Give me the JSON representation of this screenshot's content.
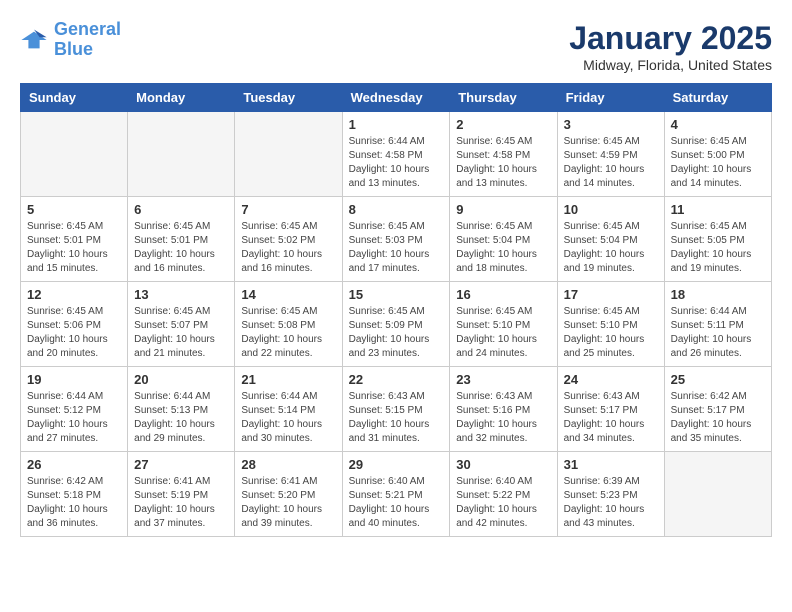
{
  "header": {
    "logo_line1": "General",
    "logo_line2": "Blue",
    "title": "January 2025",
    "subtitle": "Midway, Florida, United States"
  },
  "weekdays": [
    "Sunday",
    "Monday",
    "Tuesday",
    "Wednesday",
    "Thursday",
    "Friday",
    "Saturday"
  ],
  "weeks": [
    [
      {
        "day": "",
        "info": ""
      },
      {
        "day": "",
        "info": ""
      },
      {
        "day": "",
        "info": ""
      },
      {
        "day": "1",
        "info": "Sunrise: 6:44 AM\nSunset: 4:58 PM\nDaylight: 10 hours\nand 13 minutes."
      },
      {
        "day": "2",
        "info": "Sunrise: 6:45 AM\nSunset: 4:58 PM\nDaylight: 10 hours\nand 13 minutes."
      },
      {
        "day": "3",
        "info": "Sunrise: 6:45 AM\nSunset: 4:59 PM\nDaylight: 10 hours\nand 14 minutes."
      },
      {
        "day": "4",
        "info": "Sunrise: 6:45 AM\nSunset: 5:00 PM\nDaylight: 10 hours\nand 14 minutes."
      }
    ],
    [
      {
        "day": "5",
        "info": "Sunrise: 6:45 AM\nSunset: 5:01 PM\nDaylight: 10 hours\nand 15 minutes."
      },
      {
        "day": "6",
        "info": "Sunrise: 6:45 AM\nSunset: 5:01 PM\nDaylight: 10 hours\nand 16 minutes."
      },
      {
        "day": "7",
        "info": "Sunrise: 6:45 AM\nSunset: 5:02 PM\nDaylight: 10 hours\nand 16 minutes."
      },
      {
        "day": "8",
        "info": "Sunrise: 6:45 AM\nSunset: 5:03 PM\nDaylight: 10 hours\nand 17 minutes."
      },
      {
        "day": "9",
        "info": "Sunrise: 6:45 AM\nSunset: 5:04 PM\nDaylight: 10 hours\nand 18 minutes."
      },
      {
        "day": "10",
        "info": "Sunrise: 6:45 AM\nSunset: 5:04 PM\nDaylight: 10 hours\nand 19 minutes."
      },
      {
        "day": "11",
        "info": "Sunrise: 6:45 AM\nSunset: 5:05 PM\nDaylight: 10 hours\nand 19 minutes."
      }
    ],
    [
      {
        "day": "12",
        "info": "Sunrise: 6:45 AM\nSunset: 5:06 PM\nDaylight: 10 hours\nand 20 minutes."
      },
      {
        "day": "13",
        "info": "Sunrise: 6:45 AM\nSunset: 5:07 PM\nDaylight: 10 hours\nand 21 minutes."
      },
      {
        "day": "14",
        "info": "Sunrise: 6:45 AM\nSunset: 5:08 PM\nDaylight: 10 hours\nand 22 minutes."
      },
      {
        "day": "15",
        "info": "Sunrise: 6:45 AM\nSunset: 5:09 PM\nDaylight: 10 hours\nand 23 minutes."
      },
      {
        "day": "16",
        "info": "Sunrise: 6:45 AM\nSunset: 5:10 PM\nDaylight: 10 hours\nand 24 minutes."
      },
      {
        "day": "17",
        "info": "Sunrise: 6:45 AM\nSunset: 5:10 PM\nDaylight: 10 hours\nand 25 minutes."
      },
      {
        "day": "18",
        "info": "Sunrise: 6:44 AM\nSunset: 5:11 PM\nDaylight: 10 hours\nand 26 minutes."
      }
    ],
    [
      {
        "day": "19",
        "info": "Sunrise: 6:44 AM\nSunset: 5:12 PM\nDaylight: 10 hours\nand 27 minutes."
      },
      {
        "day": "20",
        "info": "Sunrise: 6:44 AM\nSunset: 5:13 PM\nDaylight: 10 hours\nand 29 minutes."
      },
      {
        "day": "21",
        "info": "Sunrise: 6:44 AM\nSunset: 5:14 PM\nDaylight: 10 hours\nand 30 minutes."
      },
      {
        "day": "22",
        "info": "Sunrise: 6:43 AM\nSunset: 5:15 PM\nDaylight: 10 hours\nand 31 minutes."
      },
      {
        "day": "23",
        "info": "Sunrise: 6:43 AM\nSunset: 5:16 PM\nDaylight: 10 hours\nand 32 minutes."
      },
      {
        "day": "24",
        "info": "Sunrise: 6:43 AM\nSunset: 5:17 PM\nDaylight: 10 hours\nand 34 minutes."
      },
      {
        "day": "25",
        "info": "Sunrise: 6:42 AM\nSunset: 5:17 PM\nDaylight: 10 hours\nand 35 minutes."
      }
    ],
    [
      {
        "day": "26",
        "info": "Sunrise: 6:42 AM\nSunset: 5:18 PM\nDaylight: 10 hours\nand 36 minutes."
      },
      {
        "day": "27",
        "info": "Sunrise: 6:41 AM\nSunset: 5:19 PM\nDaylight: 10 hours\nand 37 minutes."
      },
      {
        "day": "28",
        "info": "Sunrise: 6:41 AM\nSunset: 5:20 PM\nDaylight: 10 hours\nand 39 minutes."
      },
      {
        "day": "29",
        "info": "Sunrise: 6:40 AM\nSunset: 5:21 PM\nDaylight: 10 hours\nand 40 minutes."
      },
      {
        "day": "30",
        "info": "Sunrise: 6:40 AM\nSunset: 5:22 PM\nDaylight: 10 hours\nand 42 minutes."
      },
      {
        "day": "31",
        "info": "Sunrise: 6:39 AM\nSunset: 5:23 PM\nDaylight: 10 hours\nand 43 minutes."
      },
      {
        "day": "",
        "info": ""
      }
    ]
  ]
}
